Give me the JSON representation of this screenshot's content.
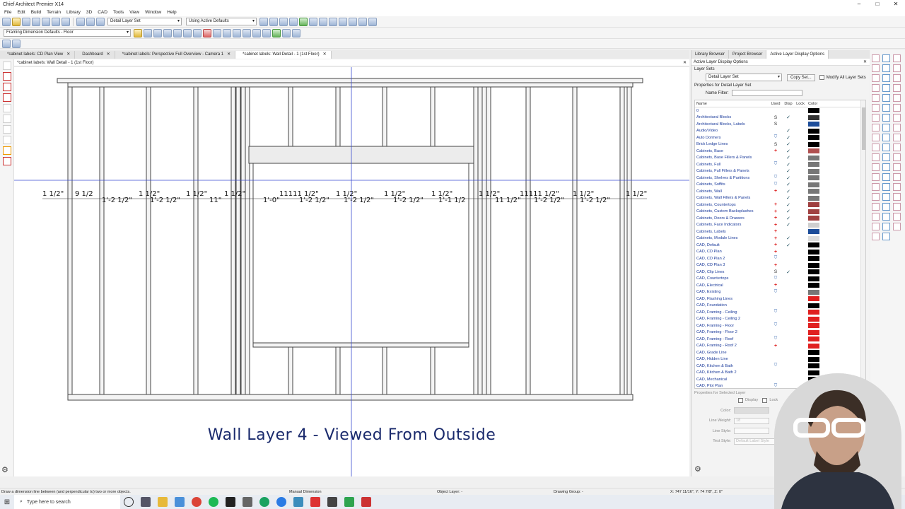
{
  "app": {
    "title": "Chief Architect Premier X14",
    "menu": [
      "File",
      "Edit",
      "Build",
      "Terrain",
      "Library",
      "3D",
      "CAD",
      "Tools",
      "View",
      "Window",
      "Help"
    ],
    "layer_set_combo": "Detail Layer Set",
    "active_defaults_combo": "Using Active Defaults",
    "framing_defaults_combo": "Framing Dimension Defaults - Floor"
  },
  "tabs": [
    {
      "label": "*cabinet labels: CD Plan View"
    },
    {
      "label": "Dashboard"
    },
    {
      "label": "*cabinet labels: Perspective Full Overview - Camera 1"
    },
    {
      "label": "*cabinet labels: Wall Detail - 1 (1st Floor)"
    }
  ],
  "view": {
    "header": "*cabinet labels: Wall Detail - 1 (1st Floor)",
    "wall_title": "Wall Layer 4 - Viewed From Outside",
    "top_dims": [
      "1 1/2\"",
      "9 1/2",
      "1 1/2\"",
      "1 1/2\"",
      "1 1/2\"",
      "1 1/2\"",
      "11111 1/2\"",
      "1 1/2\"",
      "1 1/2\"",
      "1 1/2\"",
      "1 1/2\"",
      "11111 1/2\"",
      "1 1/2\"",
      "1 1/2\"",
      "1 1/2\""
    ],
    "bottom_dims": [
      "1'-2 1/2\"",
      "1'-2 1/2\"",
      "11\"",
      "1'-0\"",
      "1'-2 1/2\"",
      "1'-2 1/2\"",
      "1'-2 1/2\"",
      "1'-1 1/2",
      "11 1/2\"",
      "1'-2 1/2\"",
      "1'-2 1/2\""
    ]
  },
  "panel": {
    "tabs": [
      "Library Browser",
      "Project Browser",
      "Active Layer Display Options"
    ],
    "header": "Active Layer Display Options",
    "layer_sets_label": "Layer Sets",
    "layer_set_value": "Detail Layer Set",
    "copy_set": "Copy Set...",
    "modify_all": "Modify All Layer Sets",
    "properties_for": "Properties for Detail Layer Set",
    "name_filter": "Name Filter:",
    "columns": {
      "name": "Name",
      "used": "Used",
      "disp": "Disp",
      "lock": "Lock",
      "color": "Color"
    },
    "layers": [
      {
        "name": "0",
        "used": "",
        "disp": "",
        "color": "#000000"
      },
      {
        "name": "Architectural Blocks",
        "used": "S",
        "disp": "✓",
        "color": "#333333"
      },
      {
        "name": "Architectural Blocks, Labels",
        "used": "S",
        "disp": "",
        "color": "#1d4d9a"
      },
      {
        "name": "Audio/Video",
        "used": "",
        "disp": "✓",
        "color": "#000000"
      },
      {
        "name": "Auto Dormers",
        "used": "B",
        "disp": "✓",
        "color": "#000000"
      },
      {
        "name": "Brick Ledge Lines",
        "used": "S",
        "disp": "✓",
        "color": "#000000"
      },
      {
        "name": "Cabinets, Base",
        "used": "+",
        "disp": "✓",
        "color": "#b05050"
      },
      {
        "name": "Cabinets, Base Fillers & Panels",
        "used": "",
        "disp": "✓",
        "color": "#777777"
      },
      {
        "name": "Cabinets, Full",
        "used": "B",
        "disp": "✓",
        "color": "#777777"
      },
      {
        "name": "Cabinets, Full Fillers & Panels",
        "used": "",
        "disp": "✓",
        "color": "#777777"
      },
      {
        "name": "Cabinets, Shelves & Partitions",
        "used": "B",
        "disp": "✓",
        "color": "#777777"
      },
      {
        "name": "Cabinets, Soffits",
        "used": "B",
        "disp": "✓",
        "color": "#777777"
      },
      {
        "name": "Cabinets, Wall",
        "used": "+",
        "disp": "✓",
        "color": "#777777"
      },
      {
        "name": "Cabinets, Wall Fillers & Panels",
        "used": "",
        "disp": "✓",
        "color": "#777777"
      },
      {
        "name": "Cabinets, Countertops",
        "used": "+",
        "disp": "✓",
        "color": "#a04040"
      },
      {
        "name": "Cabinets, Custom Backsplashes",
        "used": "+",
        "disp": "✓",
        "color": "#a04040"
      },
      {
        "name": "Cabinets, Doors & Drawers",
        "used": "+",
        "disp": "✓",
        "color": "#a04040"
      },
      {
        "name": "Cabinets, Face Indicators",
        "used": "+",
        "disp": "✓",
        "color": "#cfcfcf"
      },
      {
        "name": "Cabinets, Labels",
        "used": "+",
        "disp": "",
        "color": "#1d4d9a"
      },
      {
        "name": "Cabinets, Module Lines",
        "used": "+",
        "disp": "✓",
        "color": "#dddddd"
      },
      {
        "name": "CAD, Default",
        "used": "+",
        "disp": "✓",
        "color": "#000000"
      },
      {
        "name": "CAD, CD Plan",
        "used": "+",
        "disp": "",
        "color": "#000000"
      },
      {
        "name": "CAD, CD Plan 2",
        "used": "B",
        "disp": "",
        "color": "#000000"
      },
      {
        "name": "CAD, CD Plan 3",
        "used": "+",
        "disp": "",
        "color": "#000000"
      },
      {
        "name": "CAD, Clip Lines",
        "used": "S",
        "disp": "✓",
        "color": "#000000"
      },
      {
        "name": "CAD, Countertops",
        "used": "B",
        "disp": "",
        "color": "#000000"
      },
      {
        "name": "CAD, Electrical",
        "used": "+",
        "disp": "",
        "color": "#000000"
      },
      {
        "name": "CAD, Existing",
        "used": "B",
        "disp": "",
        "color": "#777777"
      },
      {
        "name": "CAD, Flashing Lines",
        "used": "",
        "disp": "",
        "color": "#e02020"
      },
      {
        "name": "CAD, Foundation",
        "used": "",
        "disp": "",
        "color": "#000000"
      },
      {
        "name": "CAD, Framing - Ceiling",
        "used": "B",
        "disp": "",
        "color": "#e02020"
      },
      {
        "name": "CAD, Framing - Ceiling 2",
        "used": "",
        "disp": "",
        "color": "#e02020"
      },
      {
        "name": "CAD, Framing - Floor",
        "used": "B",
        "disp": "",
        "color": "#e02020"
      },
      {
        "name": "CAD, Framing - Floor 2",
        "used": "",
        "disp": "",
        "color": "#e02020"
      },
      {
        "name": "CAD, Framing - Roof",
        "used": "B",
        "disp": "",
        "color": "#e02020"
      },
      {
        "name": "CAD, Framing - Roof 2",
        "used": "+",
        "disp": "",
        "color": "#e02020"
      },
      {
        "name": "CAD, Grade Line",
        "used": "",
        "disp": "",
        "color": "#000000"
      },
      {
        "name": "CAD, Hidden Line",
        "used": "",
        "disp": "",
        "color": "#000000"
      },
      {
        "name": "CAD, Kitchen & Bath",
        "used": "B",
        "disp": "",
        "color": "#000000"
      },
      {
        "name": "CAD, Kitchen & Bath 2",
        "used": "",
        "disp": "",
        "color": "#000000"
      },
      {
        "name": "CAD, Mechanical",
        "used": "",
        "disp": "",
        "color": "#000000"
      },
      {
        "name": "CAD, Plot Plan",
        "used": "B",
        "disp": "",
        "color": "#000000"
      }
    ],
    "selected_props": {
      "header": "Properties for Selected Layer",
      "display": "Display",
      "lock": "Lock",
      "color": "Color:",
      "line_weight": "Line Weight:",
      "line_weight_value": "18",
      "line_style": "Line Style:",
      "text_style": "Text Style:",
      "text_style_value": "Default Label Style"
    }
  },
  "status": {
    "hint": "Draw a dimension line between (and perpendicular to) two or more objects.",
    "mode": "Manual Dimension",
    "object_layer": "Object Layer: -",
    "drawing_group": "Drawing Group: -",
    "coords": "X: 747 11/16\", Y: 74 7/8\", Z: 0\""
  },
  "taskbar": {
    "search_placeholder": "Type here to search"
  },
  "colors": {
    "wall_title": "#1a2a6c",
    "stud_fill": "#f4f4f4",
    "crosshair": "#3a4bd0"
  }
}
